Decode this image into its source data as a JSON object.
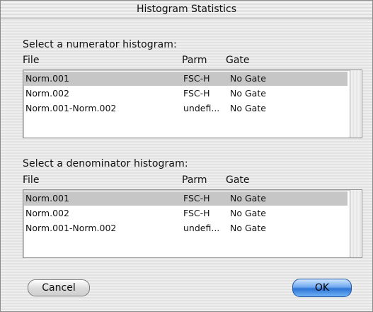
{
  "window": {
    "title": "Histogram Statistics"
  },
  "numerator": {
    "label": "Select a numerator histogram:",
    "headers": {
      "file": "File",
      "parm": "Parm",
      "gate": "Gate"
    },
    "rows": [
      {
        "file": "Norm.001",
        "parm": "FSC-H",
        "gate": "No Gate",
        "selected": true
      },
      {
        "file": "Norm.002",
        "parm": "FSC-H",
        "gate": "No Gate",
        "selected": false
      },
      {
        "file": "Norm.001-Norm.002",
        "parm": "undefi...",
        "gate": "No Gate",
        "selected": false
      }
    ]
  },
  "denominator": {
    "label": "Select a denominator histogram:",
    "headers": {
      "file": "File",
      "parm": "Parm",
      "gate": "Gate"
    },
    "rows": [
      {
        "file": "Norm.001",
        "parm": "FSC-H",
        "gate": "No Gate",
        "selected": true
      },
      {
        "file": "Norm.002",
        "parm": "FSC-H",
        "gate": "No Gate",
        "selected": false
      },
      {
        "file": "Norm.001-Norm.002",
        "parm": "undefi...",
        "gate": "No Gate",
        "selected": false
      }
    ]
  },
  "buttons": {
    "cancel": "Cancel",
    "ok": "OK"
  },
  "colors": {
    "selection": "#c6c6c6",
    "default_button": "#3d82e0"
  }
}
